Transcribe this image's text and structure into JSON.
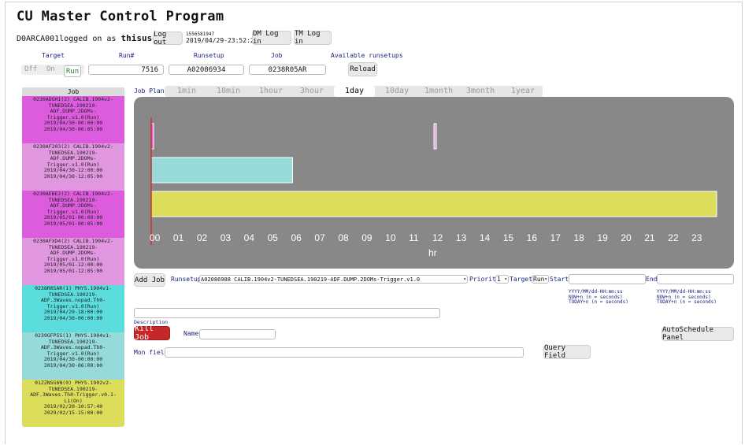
{
  "app": {
    "title": "CU Master Control Program"
  },
  "login": {
    "prefix": "D0ARCA001logged on as",
    "user": "thisuser",
    "logout_label": "Log out",
    "session_id": "1556581947",
    "session_time": "2019/04/29-23:52:27",
    "dm_login_label": "DM Log in",
    "tm_login_label": "TM Log in"
  },
  "run_controls": {
    "labels": {
      "target": "Target",
      "run": "Run#",
      "runsetup": "Runsetup",
      "job": "Job",
      "available": "Available runsetups"
    },
    "state_off": "Off",
    "state_on": "On",
    "state_run": "Run",
    "target_value": "",
    "run_number": "7516",
    "runsetup_value": "A02086934",
    "job_value": "0238R05AR",
    "reload_label": "Reload"
  },
  "jobs": {
    "header": "Job",
    "items": [
      {
        "lines": [
          "0230ADGH1(2) CALIB.1904v2-",
          "TUNEDSEA.190219-",
          "ADF.DUMP.2DOMs-",
          "Trigger.v1.0(Run)",
          "2019/04/30-00:00:00",
          "2019/04/30-00:05:00"
        ],
        "color": "#dd5cdd"
      },
      {
        "lines": [
          "0230AF203(2) CALIB.1904v2-",
          "TUNEDSEA.190219-",
          "ADF.DUMP.2DOMs-",
          "Trigger.v1.0(Run)",
          "2019/04/30-12:00:00",
          "2019/04/30-12:05:00"
        ],
        "color": "#e097e0"
      },
      {
        "lines": [
          "0230AEBE2(2) CALIB.1904v2-",
          "TUNEDSEA.190219-",
          "ADF.DUMP.2DOMs-",
          "Trigger.v1.0(Run)",
          "2019/05/01-00:00:00",
          "2019/05/01-00:05:00"
        ],
        "color": "#dd5cdd"
      },
      {
        "lines": [
          "0230AFXD4(2) CALIB.1904v2-",
          "TUNEDSEA.190219-",
          "ADF.DUMP.2DOMs-",
          "Trigger.v1.0(Run)",
          "2019/05/01-12:00:00",
          "2019/05/01-12:05:00"
        ],
        "color": "#e097e0"
      },
      {
        "lines": [
          "0238R05AR(1) PHYS.1904v1-",
          "TUNEDSEA.190219-",
          "ADF.3Waves.nopad.Th0-",
          "Trigger.v1.0(Run)",
          "2019/04/29-18:00:00",
          "2019/04/30-00:00:00"
        ],
        "color": "#5cdddd"
      },
      {
        "lines": [
          "0239GFP5S(1) PHYS.1904v1-",
          "TUNEDSEA.190219-",
          "ADF.3Waves.nopad.Th0-",
          "Trigger.v1.0(Run)",
          "2019/04/30-00:00:00",
          "2019/04/30-06:00:00"
        ],
        "color": "#97dada"
      },
      {
        "lines": [
          "01ZZNSG6N(0) PHYS.1902v2-",
          "TUNEDSEA.190219-",
          "ADF.3Waves.Th0-Trigger.v0.1-",
          "L1(On)",
          "2019/02/20-10:57:40",
          "2029/02/15-15:00:00"
        ],
        "color": "#dddd5c"
      }
    ]
  },
  "job_plan": {
    "label": "Job Plan",
    "tabs": [
      "1min",
      "10min",
      "1hour",
      "3hour",
      "1day",
      "10day",
      "1month",
      "3month",
      "1year"
    ],
    "active_tab": "1day"
  },
  "chart_data": {
    "type": "timeline",
    "xlabel": "hr",
    "xlim": [
      0,
      24
    ],
    "ticks": [
      "00",
      "01",
      "02",
      "03",
      "04",
      "05",
      "06",
      "07",
      "08",
      "09",
      "10",
      "11",
      "12",
      "13",
      "14",
      "15",
      "16",
      "17",
      "18",
      "19",
      "20",
      "21",
      "22",
      "23"
    ],
    "current_time": 0,
    "rows": [
      {
        "bars": [
          {
            "start": 0.0,
            "end": 0.083,
            "color": "#dd5cdd"
          },
          {
            "start": 12.0,
            "end": 12.083,
            "color": "#e097e0"
          }
        ]
      },
      {
        "bars": [
          {
            "start": 0.0,
            "end": 6.0,
            "color": "#97dada"
          }
        ]
      },
      {
        "bars": [
          {
            "start": 0.0,
            "end": 24.0,
            "color": "#dddd5c"
          }
        ]
      }
    ]
  },
  "add_job": {
    "add_label": "Add Job",
    "runsetup_label": "Runsetup",
    "runsetup_value": "A02086988 CALIB.1904v2-TUNEDSEA.190219-ADF.DUMP.2DOMs-Trigger.v1.0",
    "priority_label": "Priority",
    "priority_value": "1",
    "target_label": "Target",
    "target_value": "Run",
    "start_label": "Start",
    "start_value": "",
    "end_label": "End",
    "end_value": "",
    "start_help": [
      "YYYY/MM/dd-HH:mm:ss",
      "NOW+n (n = seconds)",
      "TODAY+n (n = seconds)"
    ],
    "end_help": [
      "YYYY/MM/dd-HH:mm:ss",
      "NOW+n (n = seconds)",
      "TODAY+n (n = seconds)"
    ],
    "description_label": "Description",
    "description_value": ""
  },
  "kill": {
    "kill_label": "Kill Job",
    "name_label": "Name",
    "name_value": "",
    "autoschedule_label": "AutoSchedule Panel"
  },
  "query": {
    "mon_field_label": "Mon field",
    "mon_field_value": "",
    "query_label": "Query Field"
  }
}
